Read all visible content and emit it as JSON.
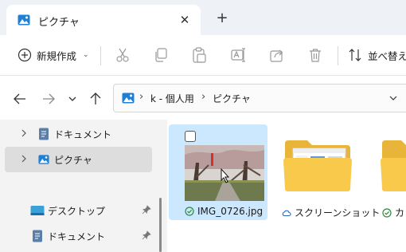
{
  "window": {
    "tab_title": "ピクチャ",
    "close_glyph": "✕",
    "new_tab_glyph": "+"
  },
  "toolbar": {
    "new_label": "新規作成",
    "new_caret": "⌄",
    "sort_label": "並べ替え",
    "icons": [
      "cut-icon",
      "copy-icon",
      "paste-icon",
      "rename-icon",
      "share-icon",
      "delete-icon"
    ]
  },
  "address": {
    "crumbs": [
      "k - 個人用",
      "ピクチャ"
    ],
    "sep": "›"
  },
  "sidebar": {
    "items": [
      {
        "label": "ドキュメント",
        "icon": "document-icon",
        "expandable": true,
        "selected": false
      },
      {
        "label": "ピクチャ",
        "icon": "pictures-icon",
        "expandable": true,
        "selected": true
      },
      {
        "label": "デスクトップ",
        "icon": "desktop-icon",
        "pinned": true
      },
      {
        "label": "ドキュメント",
        "icon": "document-icon",
        "pinned": true
      }
    ]
  },
  "files": [
    {
      "name": "IMG_0726.jpg",
      "status": "synced",
      "selected": true,
      "thumb_mark": "1"
    },
    {
      "name": "スクリーンショット",
      "status": "cloud",
      "selected": false
    },
    {
      "name": "カ",
      "status": "synced",
      "selected": false
    }
  ],
  "colors": {
    "accent": "#0067c0",
    "selection": "#cce8ff",
    "folder": "#f8c94a",
    "synced": "#2e8b3a"
  }
}
